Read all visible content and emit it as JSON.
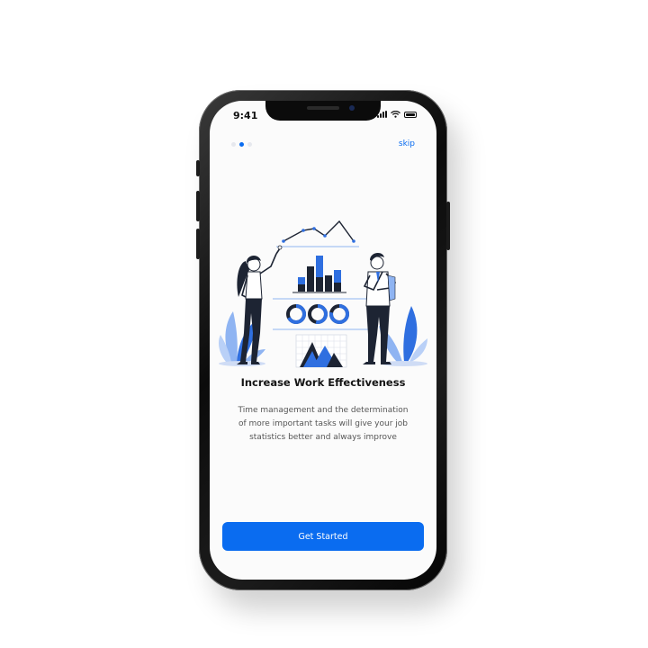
{
  "status_bar": {
    "time": "9:41"
  },
  "onboarding": {
    "pages": 3,
    "active_page": 2,
    "skip_label": "skip",
    "title": "Increase Work Effectiveness",
    "description": "Time management and the determination of more important tasks will give your job statistics better and always improve",
    "cta_label": "Get Started"
  },
  "colors": {
    "accent": "#0a6cf0",
    "illustration_blue": "#2f6fe0",
    "illustration_light": "#8fb4f2",
    "ink": "#1d2433"
  },
  "icons": [
    "signal-icon",
    "wifi-icon",
    "battery-icon"
  ]
}
